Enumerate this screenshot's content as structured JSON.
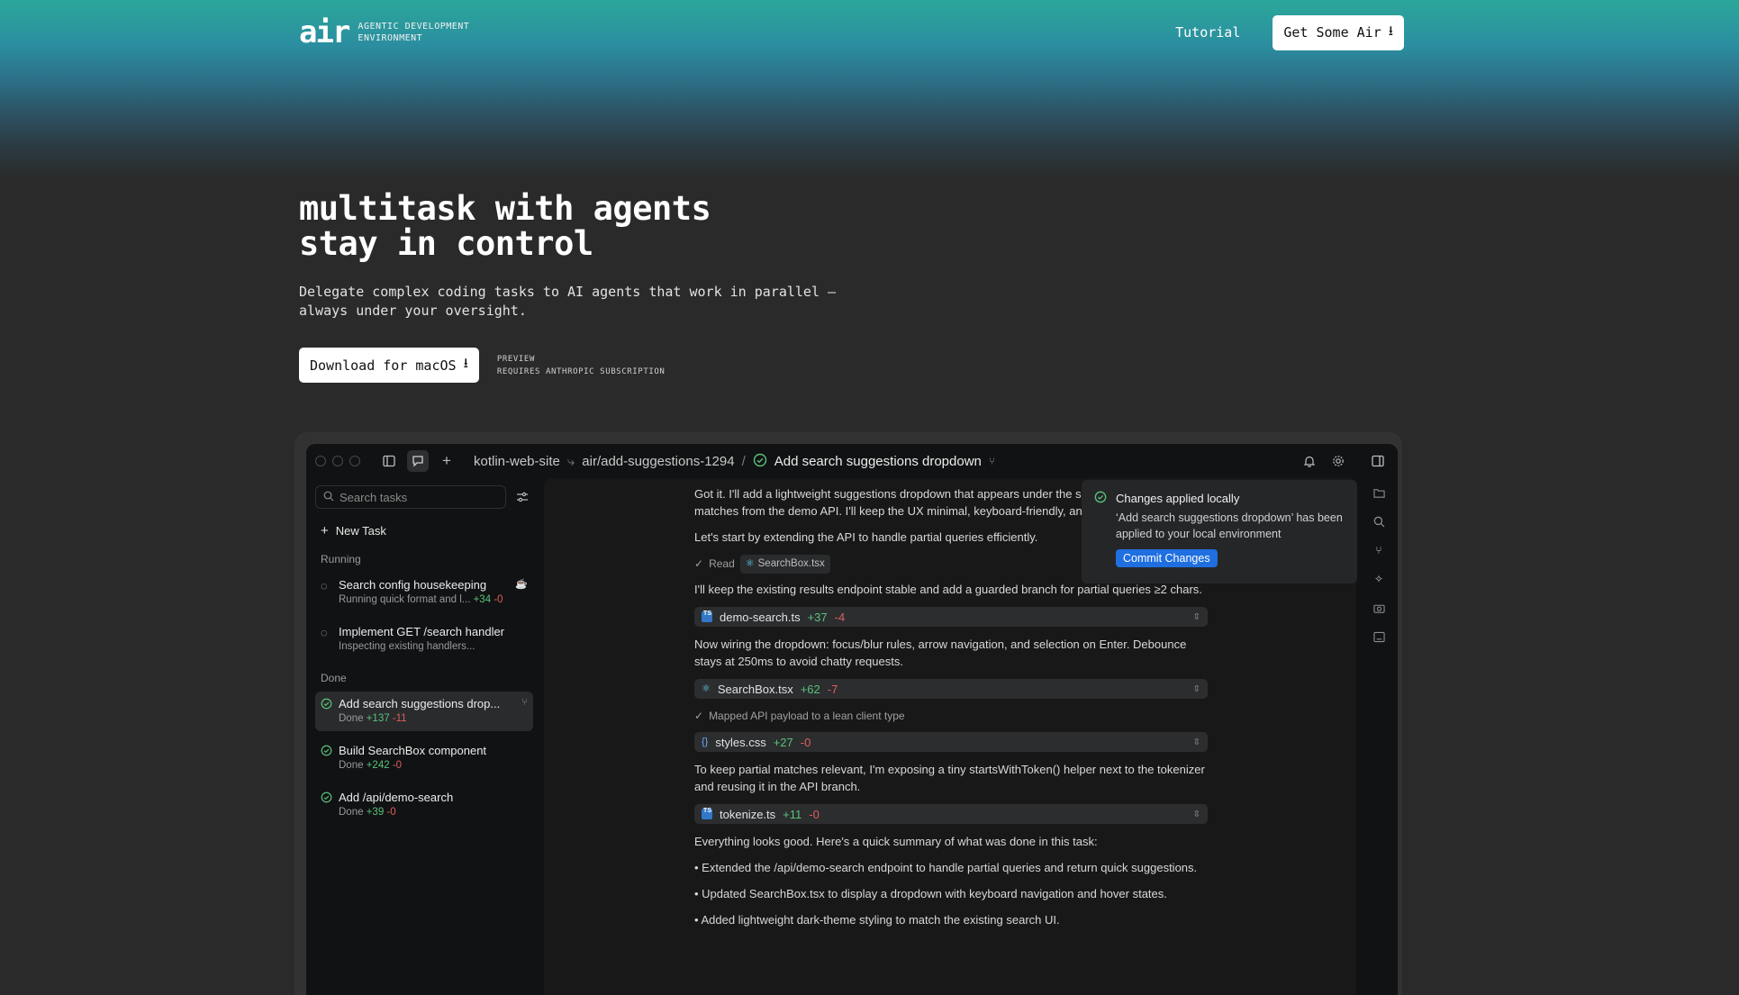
{
  "nav": {
    "logo": "air",
    "tagline_line1": "AGENTIC DEVELOPMENT",
    "tagline_line2": "ENVIRONMENT",
    "tutorial": "Tutorial",
    "get_air": "Get Some Air"
  },
  "hero": {
    "title_line1": "multitask with agents",
    "title_line2": "stay in control",
    "subtitle_line1": "Delegate complex coding tasks to AI agents that work in parallel –",
    "subtitle_line2": "always under your oversight.",
    "download": "Download for macOS",
    "note_line1": "PREVIEW",
    "note_line2": "REQUIRES ANTHROPIC SUBSCRIPTION"
  },
  "titlebar": {
    "project": "kotlin-web-site",
    "branch": "air/add-suggestions-1294",
    "separator": "/",
    "task": "Add search suggestions dropdown"
  },
  "sidebar": {
    "search_placeholder": "Search tasks",
    "new_task": "New Task",
    "running_label": "Running",
    "done_label": "Done",
    "running": [
      {
        "title": "Search config housekeeping",
        "status": "Running quick format and l...",
        "add": "+34",
        "del": "-0"
      },
      {
        "title": "Implement GET /search handler",
        "status": "Inspecting existing handlers...",
        "add": "",
        "del": ""
      }
    ],
    "done": [
      {
        "title": "Add search suggestions drop...",
        "status": "Done",
        "add": "+137",
        "del": "-11"
      },
      {
        "title": "Build SearchBox component",
        "status": "Done",
        "add": "+242",
        "del": "-0"
      },
      {
        "title": "Add /api/demo-search",
        "status": "Done",
        "add": "+39",
        "del": "-0"
      }
    ]
  },
  "chat": {
    "p1": "Got it. I'll add a lightweight suggestions dropdown that appears under the search bar for partial matches from the demo API. I'll keep the UX minimal, keyboard-friendly, and consistent.",
    "p2": "Let's start by extending the API to handle partial queries efficiently.",
    "read_label": "Read",
    "read_file": "SearchBox.tsx",
    "p3": "I'll keep the existing results endpoint stable and add a guarded branch for partial queries ≥2 chars.",
    "file1": {
      "name": "demo-search.ts",
      "add": "+37",
      "del": "-4"
    },
    "p4": "Now wiring the dropdown: focus/blur rules, arrow navigation, and selection on Enter. Debounce stays at 250ms to avoid chatty requests.",
    "file2": {
      "name": "SearchBox.tsx",
      "add": "+62",
      "del": "-7"
    },
    "mapped": "Mapped API payload to a lean client type",
    "file3": {
      "name": "styles.css",
      "add": "+27",
      "del": "-0"
    },
    "p5": "To keep partial matches relevant, I'm exposing a tiny startsWithToken() helper next to the tokenizer and reusing it in the API branch.",
    "file4": {
      "name": "tokenize.ts",
      "add": "+11",
      "del": "-0"
    },
    "p6": "Everything looks good. Here's a quick summary of what was done in this task:",
    "bullets": [
      "Extended the /api/demo-search endpoint to handle partial queries and return quick suggestions.",
      "Updated SearchBox.tsx to display a dropdown with keyboard navigation and hover states.",
      "Added lightweight dark-theme styling to match the existing search UI."
    ]
  },
  "toast": {
    "title": "Changes applied locally",
    "body": "‘Add search suggestions dropdown’ has been applied to your local environment",
    "button": "Commit Changes"
  },
  "colors": {
    "accent": "#1f6fe0",
    "added": "#58c27d",
    "removed": "#e05d5d"
  }
}
